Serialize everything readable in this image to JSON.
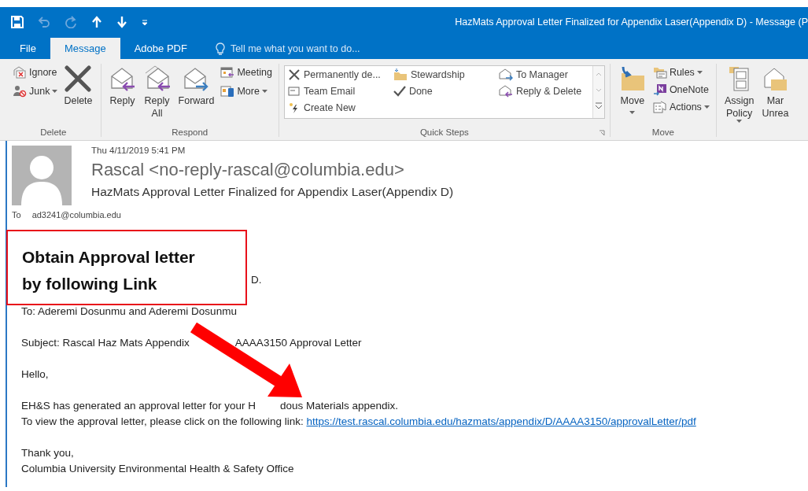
{
  "title": "HazMats Approval Letter Finalized for Appendix Laser(Appendix D) - Message (P",
  "tabs": [
    {
      "label": "File",
      "selected": false
    },
    {
      "label": "Message",
      "selected": true
    },
    {
      "label": "Adobe PDF",
      "selected": false
    }
  ],
  "tell_me": {
    "placeholder": "Tell me what you want to do..."
  },
  "ribbon": {
    "delete": {
      "label": "Delete",
      "ignore": "Ignore",
      "junk": "Junk",
      "delete": "Delete"
    },
    "respond": {
      "label": "Respond",
      "reply": "Reply",
      "reply_all": [
        "Reply",
        "All"
      ],
      "forward": "Forward",
      "meeting": "Meeting",
      "more": "More"
    },
    "quick_steps": {
      "label": "Quick Steps",
      "items": [
        "Permanently de...",
        "Team Email",
        "Create New",
        "Stewardship",
        "Done",
        "To Manager",
        "Reply & Delete"
      ]
    },
    "move": {
      "label": "Move",
      "move": "Move",
      "rules": "Rules",
      "onenote": "OneNote",
      "actions": "Actions"
    },
    "tags": {
      "assign": [
        "Assign",
        "Policy"
      ],
      "mark": [
        "Mar",
        "Unrea"
      ]
    }
  },
  "message": {
    "date": "Thu 4/11/2019 5:41 PM",
    "sender": "Rascal <no-reply-rascal@columbia.edu>",
    "subject": "HazMats Approval Letter Finalized for Appendix Laser(Appendix D)",
    "to_label": "To",
    "to": "ad3241@columbia.edu"
  },
  "body": {
    "line_1_tail": "D.",
    "to_line": "To: Aderemi Dosunmu and Aderemi Dosunmu",
    "subject_line": [
      "Subject: Rascal Haz Mats Appendix",
      "AAAA3150 Approval Letter"
    ],
    "greeting": "Hello,",
    "generated": [
      "EH&S has generated an approval letter for your H",
      "dous Materials appendix."
    ],
    "view_prefix": "To view the approval letter, please click on the following link:",
    "link": "https://test.rascal.columbia.edu/hazmats/appendix/D/AAAA3150/approvalLetter/pdf",
    "thanks": "Thank you,",
    "signature": "Columbia University Environmental Health & Safety Office"
  },
  "callout": {
    "text": [
      "Obtain Approval letter",
      "by following Link"
    ]
  }
}
